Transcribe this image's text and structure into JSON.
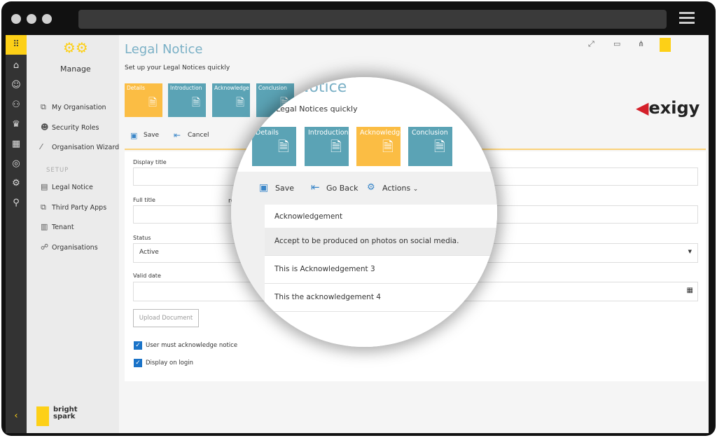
{
  "sidebar": {
    "heading": "Manage",
    "section": "SETUP",
    "items": [
      {
        "label": "My Organisation",
        "icon": "org-chart-icon"
      },
      {
        "label": "Security Roles",
        "icon": "users-lock-icon"
      },
      {
        "label": "Organisation Wizard",
        "icon": "wand-icon"
      },
      {
        "label": "Legal Notice",
        "icon": "document-icon"
      },
      {
        "label": "Third Party Apps",
        "icon": "apps-icon"
      },
      {
        "label": "Tenant",
        "icon": "building-icon"
      },
      {
        "label": "Organisations",
        "icon": "hierarchy-icon"
      }
    ],
    "logo": "bright spark"
  },
  "page": {
    "title": "Legal Notice",
    "subtitle": "Set up your Legal Notices quickly",
    "tiles": [
      "Details",
      "Introduction",
      "Acknowledge",
      "Conclusion"
    ],
    "active_tile": "Details",
    "toolbar": {
      "save": "Save",
      "cancel": "Cancel"
    },
    "form": {
      "display_title_label": "Display title",
      "full_title_label": "Full title",
      "status_label": "Status",
      "status_value": "Active",
      "valid_date_label": "Valid date",
      "upload": "Upload Document",
      "partial_text": "rd",
      "check1": "User must acknowledge notice",
      "check2": "Display on login"
    }
  },
  "magnifier": {
    "title_partial": "Notice",
    "subtitle_partial": "your Legal Notices quickly",
    "active_tile": "Acknowledge",
    "toolbar": {
      "save": "Save",
      "go_back": "Go Back",
      "actions": "Actions"
    },
    "rows": [
      "Acknowledgement",
      "Accept to be produced on photos on social media.",
      "This is Acknowledgement 3",
      "This the acknowledgement 4"
    ]
  },
  "brand": {
    "logo": "exigy"
  },
  "colors": {
    "yellow": "#fbbd44",
    "teal": "#5ba3b5",
    "accent": "#fdd017"
  }
}
